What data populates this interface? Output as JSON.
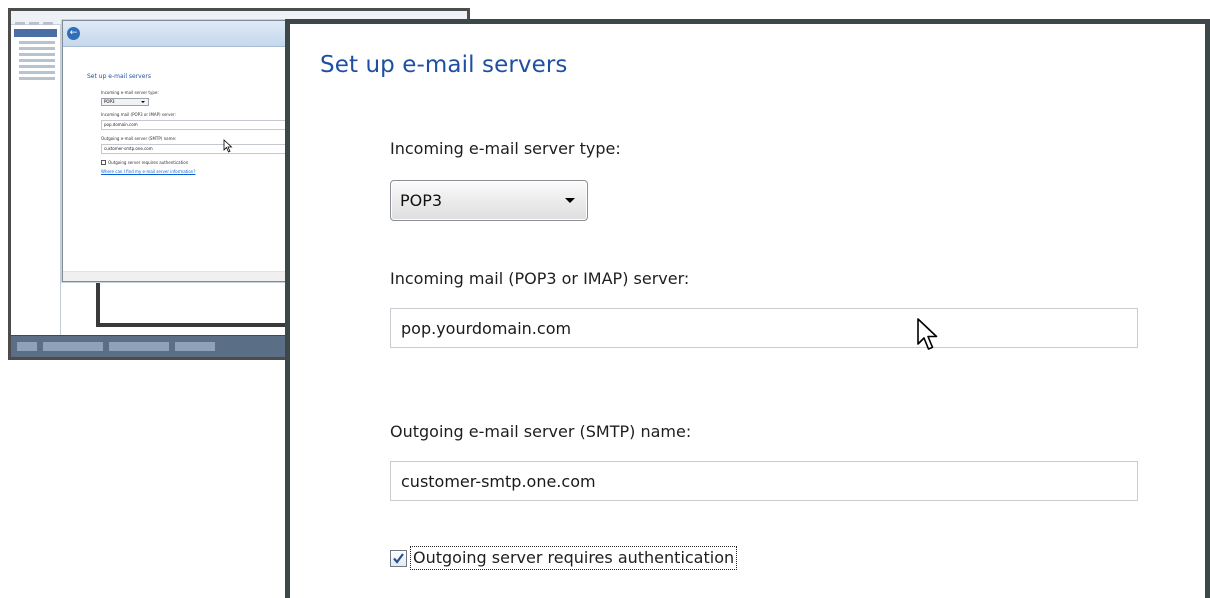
{
  "dialog": {
    "title": "Set up e-mail servers",
    "incoming_type_label": "Incoming e-mail server type:",
    "incoming_type_value": "POP3",
    "incoming_server_label": "Incoming mail (POP3 or IMAP) server:",
    "incoming_server_value": "pop.yourdomain.com",
    "outgoing_server_label": "Outgoing e-mail server (SMTP) name:",
    "outgoing_server_value": "customer-smtp.one.com",
    "auth_checkbox_label": "Outgoing server requires authentication",
    "auth_checkbox_checked": true
  },
  "thumbnail": {
    "title": "Set up e-mail servers",
    "incoming_type_label": "Incoming e-mail server type:",
    "incoming_type_value": "POP3",
    "incoming_server_label": "Incoming mail (POP3 or IMAP) server:",
    "incoming_server_value": "pop.domain.com",
    "outgoing_server_label": "Outgoing e-mail server (SMTP) name:",
    "outgoing_server_value": "customer-smtp.one.com",
    "auth_checkbox_label": "Outgoing server requires authentication",
    "help_link": "Where can I find my e-mail server information?"
  },
  "icons": {
    "back": "back-arrow-icon",
    "dropdown": "chevron-down-icon",
    "check": "checkmark-icon",
    "cursor": "mouse-pointer-icon"
  },
  "colors": {
    "title_blue": "#1f4fa3",
    "frame_dark": "#3d4649",
    "link_blue": "#0b5fd6"
  }
}
